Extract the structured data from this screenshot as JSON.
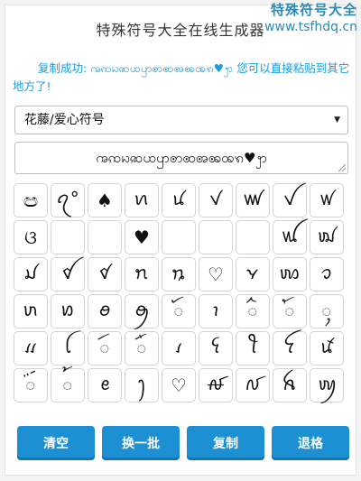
{
  "page": {
    "title": "特殊符号大全在线生成器"
  },
  "watermark": {
    "line1": "特殊符号大全",
    "line2": "www.tsfhdq.cn"
  },
  "status": {
    "prefix": "复制成功:",
    "copied_text": "ꩠꩡꩢꩣꩤꩥꩦꩧꩨꩩꩪꩫ♥ꩭ",
    "suffix": "您可以直接粘贴到其它地方了!"
  },
  "category_select": {
    "selected": "花藤/爱心符号"
  },
  "output": {
    "value": "ꩠꩡꩢꩣꩤꩥꩦꩧꩨꩩꩪꩫ♥ꩭ"
  },
  "symbols": [
    "ඏ",
    "ꪖ°",
    "♠",
    "ꪕ",
    "ꪙ",
    "ꪚ",
    "ꪛ",
    "ꪜ",
    "ꪝ",
    "ଓ",
    "ㅤ",
    "ㅤ",
    "♥",
    "ㅤ",
    "ㅤ",
    "ㅤ",
    "ꪡ",
    "ꪢ",
    "ꪣ",
    "ꪤ",
    "ꪥ",
    "ꪦ",
    "ꪧ",
    "♡",
    "ꪩ",
    "ꪪ",
    "ꪫ",
    "ꪬ",
    "ꪭ",
    "ꪮ",
    "ꪯ",
    "ꪰ",
    "ꪱ",
    "ꪲ",
    "ꪳ",
    "ꪴ",
    "ꪵ",
    "ꪶ",
    "ꪷ",
    "ꪸ",
    "ꪹ",
    "ꪺ",
    "ꪻ",
    "ꪼ",
    "ꪽ",
    "ꪾ",
    "꫁",
    "ꫀ",
    "ꫂ",
    "♡",
    "ꫛ",
    "ꫜ",
    "ꫝ",
    "ꪐ"
  ],
  "buttons": {
    "clear": "清空",
    "next_batch": "换一批",
    "copy": "复制",
    "backspace": "退格"
  }
}
